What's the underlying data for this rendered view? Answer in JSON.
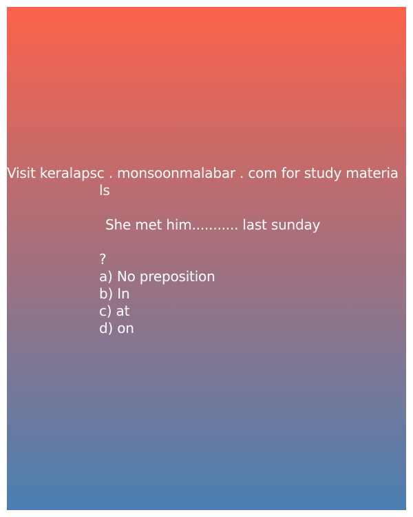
{
  "card": {
    "visit_line_1": "Visit keralapsc . monsoonmalabar . com for study materia",
    "visit_line_2": "ls",
    "question": "She met him........... last sunday",
    "question_mark": "?",
    "options": [
      "a) No preposition",
      "b) In",
      "c) at",
      "d) on"
    ]
  },
  "colors": {
    "gradient_top": "#fc624a",
    "gradient_bottom": "#4a7fb2",
    "text": "#ffffff"
  }
}
